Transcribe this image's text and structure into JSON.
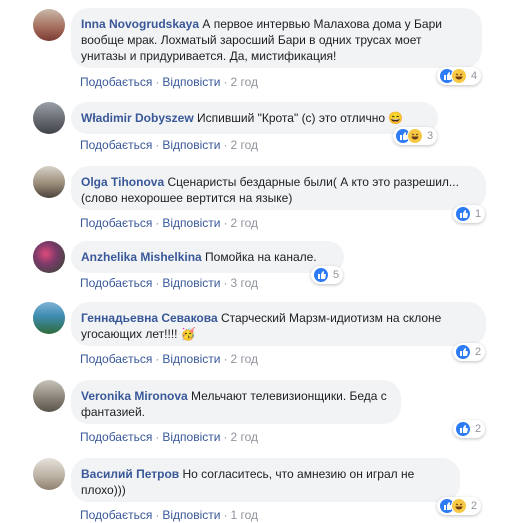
{
  "actions": {
    "like": "Подобається",
    "reply": "Відповісти",
    "sep": "·"
  },
  "comments": [
    {
      "author": "Inna Novogrudskaya",
      "text": "А первое интервью Малахова дома у Бари вообще мрак. Лохматый заросший Бари в одних трусах моет унитазы и придуривается. Да, мистификация!",
      "time": "2 год",
      "reactions": [
        "like",
        "haha"
      ],
      "count": "4"
    },
    {
      "author": "Władimir Dobyszew",
      "text": "Испивший \"Крота\" (с) это отлично 😄",
      "time": "2 год",
      "reactions": [
        "like",
        "haha"
      ],
      "count": "3"
    },
    {
      "author": "Olga Tihonova",
      "text": "Сценаристы бездарные были( А кто это разрешил... (слово нехорошее вертится на языке)",
      "time": "2 год",
      "reactions": [
        "like"
      ],
      "count": "1"
    },
    {
      "author": "Anzhelika Mishelkina",
      "text": "Помойка на канале.",
      "time": "3 год",
      "reactions": [
        "like"
      ],
      "count": "5"
    },
    {
      "author": "Геннадьевна Севакова",
      "text": "Старческий Марзм-идиотизм на склоне угосающих лет!!!! 🥳",
      "time": "2 год",
      "reactions": [
        "like"
      ],
      "count": "2"
    },
    {
      "author": "Veronika Mironova",
      "text": "Мельчают телевизионщики. Беда с фантазией.",
      "time": "2 год",
      "reactions": [
        "like"
      ],
      "count": "2"
    },
    {
      "author": "Василий Петров",
      "text": "Но согласитесь, что амнезию он играл не плохо)))",
      "time": "1 год",
      "reactions": [
        "like",
        "haha"
      ],
      "count": "2"
    }
  ],
  "colors": {
    "link": "#385898",
    "bubble": "#f2f3f5",
    "like": "#2e7bf6",
    "haha": "#f7c844"
  }
}
